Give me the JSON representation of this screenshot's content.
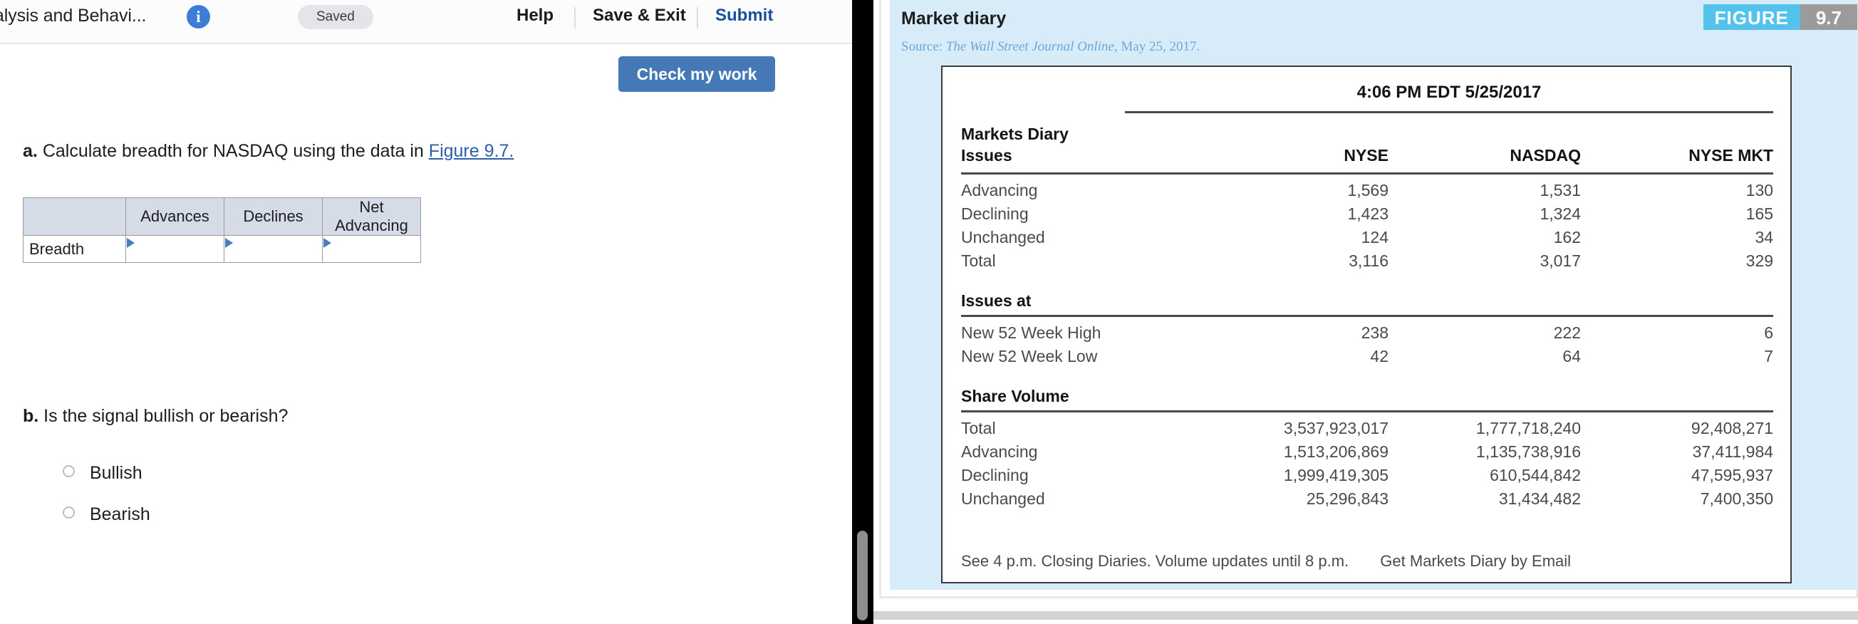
{
  "toolbar": {
    "assignment_title": "alysis and Behavi...",
    "info_icon": "info-icon",
    "saved_status": "Saved",
    "help_label": "Help",
    "save_exit_label": "Save & Exit",
    "submit_label": "Submit",
    "check_my_work_label": "Check my work",
    "accent_blue": "#4479b5",
    "submit_blue": "#1b4f9c"
  },
  "questions": {
    "a": {
      "prefix": "a.",
      "text": "Calculate breadth for NASDAQ using the data in",
      "link_text": "Figure 9.7."
    },
    "b": {
      "prefix": "b.",
      "text": "Is the signal bullish or bearish?"
    }
  },
  "breadth_table": {
    "headers": [
      "",
      "Advances",
      "Declines",
      "Net Advancing"
    ],
    "row_label": "Breadth",
    "values": [
      "",
      "",
      ""
    ],
    "placeholders": [
      "",
      "",
      ""
    ]
  },
  "choices": [
    {
      "label": "Bullish",
      "selected": false
    },
    {
      "label": "Bearish",
      "selected": false
    }
  ],
  "figure": {
    "title": "Market diary",
    "source_prefix": "Source:",
    "source_italic": "The Wall Street Journal Online",
    "source_suffix": ", May 25, 2017.",
    "badge_word": "FIGURE",
    "badge_number": "9.7",
    "badge_word_color": "#53c3ee",
    "badge_number_color": "#9b9b9b",
    "panel_color": "#d8ebf9"
  },
  "chart_data": {
    "type": "table",
    "title": "Markets Diary",
    "timestamp": "4:06 PM EDT 5/25/2017",
    "columns": [
      "NYSE",
      "NASDAQ",
      "NYSE MKT"
    ],
    "sections": [
      {
        "name": "Issues",
        "rows": [
          {
            "label": "Advancing",
            "values": [
              "1,569",
              "1,531",
              "130"
            ]
          },
          {
            "label": "Declining",
            "values": [
              "1,423",
              "1,324",
              "165"
            ]
          },
          {
            "label": "Unchanged",
            "values": [
              "124",
              "162",
              "34"
            ]
          },
          {
            "label": "Total",
            "values": [
              "3,116",
              "3,017",
              "329"
            ]
          }
        ]
      },
      {
        "name": "Issues at",
        "rows": [
          {
            "label": "New 52 Week High",
            "values": [
              "238",
              "222",
              "6"
            ]
          },
          {
            "label": "New 52 Week Low",
            "values": [
              "42",
              "64",
              "7"
            ]
          }
        ]
      },
      {
        "name": "Share Volume",
        "rows": [
          {
            "label": "Total",
            "values": [
              "3,537,923,017",
              "1,777,718,240",
              "92,408,271"
            ]
          },
          {
            "label": "Advancing",
            "values": [
              "1,513,206,869",
              "1,135,738,916",
              "37,411,984"
            ]
          },
          {
            "label": "Declining",
            "values": [
              "1,999,419,305",
              "610,544,842",
              "47,595,937"
            ]
          },
          {
            "label": "Unchanged",
            "values": [
              "25,296,843",
              "31,434,482",
              "7,400,350"
            ]
          }
        ]
      }
    ],
    "footnote": "See 4 p.m. Closing Diaries. Volume updates until 8 p.m.",
    "email_link": "Get Markets Diary by Email"
  }
}
